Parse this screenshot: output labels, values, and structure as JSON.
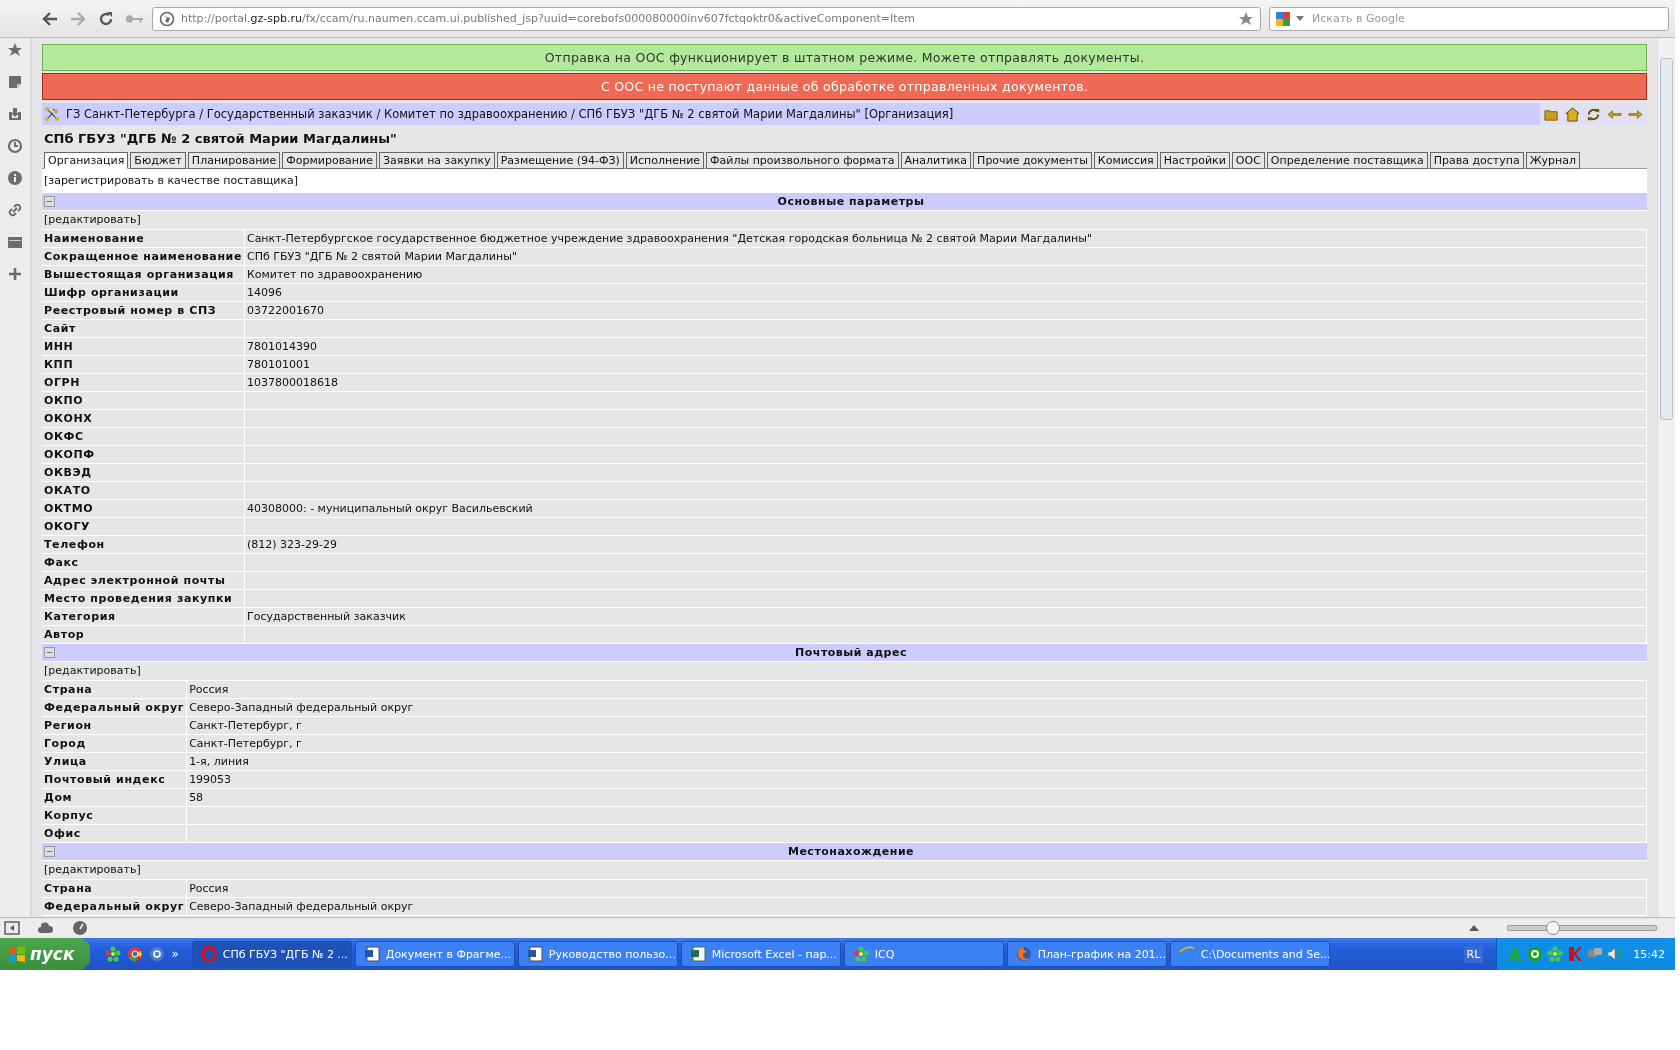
{
  "browser": {
    "url_host_prefix": "http://portal.",
    "url_host": "gz-spb.ru",
    "url_rest": "/fx/ccam/ru.naumen.ccam.ui.published_jsp?uuid=corebofs000080000inv607fctqoktr0&activeComponent=Item",
    "search_placeholder": "Искать в Google"
  },
  "notices": [
    {
      "kind": "ok",
      "text": "Отправка на ООС функционирует в штатном режиме. Можете отправлять документы."
    },
    {
      "kind": "error",
      "text": "С ООС не поступают данные об обработке отправленных документов."
    }
  ],
  "breadcrumb": "ГЗ Санкт-Петербурга / Государственный заказчик / Комитет по здравоохранению / СПб ГБУЗ \"ДГБ № 2 святой Марии Магдалины\" [Организация]",
  "page_title": "СПб ГБУЗ \"ДГБ № 2 святой Марии Магдалины\"",
  "tabs": [
    {
      "label": "Организация",
      "selected": true
    },
    {
      "label": "Бюджет",
      "selected": false
    },
    {
      "label": "Планирование",
      "selected": false
    },
    {
      "label": "Формирование",
      "selected": false
    },
    {
      "label": "Заявки на закупку",
      "selected": false
    },
    {
      "label": "Размещение (94-ФЗ)",
      "selected": false
    },
    {
      "label": "Исполнение",
      "selected": false
    },
    {
      "label": "Файлы произвольного формата",
      "selected": false
    },
    {
      "label": "Аналитика",
      "selected": false
    },
    {
      "label": "Прочие документы",
      "selected": false
    },
    {
      "label": "Комиссия",
      "selected": false
    },
    {
      "label": "Настройки",
      "selected": false
    },
    {
      "label": "ООС",
      "selected": false
    },
    {
      "label": "Определение поставщика",
      "selected": false
    },
    {
      "label": "Права доступа",
      "selected": false
    },
    {
      "label": "Журнал",
      "selected": false
    }
  ],
  "register_link": "[зарегистрировать в качестве поставщика]",
  "sections": [
    {
      "title": "Основные параметры",
      "collapse_mark": "−",
      "edit_link": "[редактировать]",
      "rows": [
        {
          "label": "Наименование",
          "value": "Санкт-Петербургское государственное бюджетное учреждение здравоохранения \"Детская городская больница № 2 святой Марии Магдалины\""
        },
        {
          "label": "Сокращенное наименование",
          "value": "СПб ГБУЗ \"ДГБ № 2 святой Марии Магдалины\""
        },
        {
          "label": "Вышестоящая организация",
          "value": "Комитет по здравоохранению"
        },
        {
          "label": "Шифр организации",
          "value": "14096"
        },
        {
          "label": "Реестровый номер в СПЗ",
          "value": "03722001670"
        },
        {
          "label": "Сайт"
        },
        {
          "label": "ИНН",
          "value": "7801014390"
        },
        {
          "label": "КПП",
          "value": "780101001"
        },
        {
          "label": "ОГРН",
          "value": "1037800018618"
        },
        {
          "label": "ОКПО"
        },
        {
          "label": "ОКОНХ"
        },
        {
          "label": "ОКФС"
        },
        {
          "label": "ОКОПФ"
        },
        {
          "label": "ОКВЭД"
        },
        {
          "label": "ОКАТО"
        },
        {
          "label": "ОКТМО",
          "value": "40308000: - муниципальный округ Васильевский"
        },
        {
          "label": "ОКОГУ"
        },
        {
          "label": "Телефон",
          "value": "(812) 323-29-29"
        },
        {
          "label": "Факс"
        },
        {
          "label": "Адрес электронной почты"
        },
        {
          "label": "Место проведения закупки"
        },
        {
          "label": "Категория",
          "value": "Государственный заказчик"
        },
        {
          "label": "Автор"
        }
      ]
    },
    {
      "title": "Почтовый адрес",
      "collapse_mark": "−",
      "edit_link": "[редактировать]",
      "rows": [
        {
          "label": "Страна",
          "value": "Россия"
        },
        {
          "label": "Федеральный округ",
          "value": "Северо-Западный федеральный округ"
        },
        {
          "label": "Регион",
          "value": "Санкт-Петербург, г"
        },
        {
          "label": "Город",
          "value": "Санкт-Петербург, г"
        },
        {
          "label": "Улица",
          "value": "1-я, линия"
        },
        {
          "label": "Почтовый индекс",
          "value": "199053"
        },
        {
          "label": "Дом",
          "value": "58"
        },
        {
          "label": "Корпус"
        },
        {
          "label": "Офис"
        }
      ]
    },
    {
      "title": "Местонахождение",
      "collapse_mark": "−",
      "edit_link": "[редактировать]",
      "rows": [
        {
          "label": "Страна",
          "value": "Россия"
        },
        {
          "label": "Федеральный округ",
          "value": "Северо-Западный федеральный округ"
        }
      ]
    }
  ],
  "status_bar": {
    "zoom": {
      "level": 0.3
    }
  },
  "taskbar": {
    "start_label": "пуск",
    "more_mark": "»",
    "tasks": [
      {
        "kind": "opera",
        "label": "СПб ГБУЗ \"ДГБ № 2 ...",
        "selected": true
      },
      {
        "kind": "word",
        "label": "Документ в Фрагме...",
        "selected": false
      },
      {
        "kind": "word",
        "label": "Руководство пользо...",
        "selected": false
      },
      {
        "kind": "excel",
        "label": "Microsoft Excel - пар...",
        "selected": false
      },
      {
        "kind": "icq",
        "label": "ICQ",
        "selected": false
      },
      {
        "kind": "firefox",
        "label": "План-график на 201...",
        "selected": false
      },
      {
        "kind": "ie",
        "label": "C:\\Documents and Se...",
        "selected": false
      }
    ],
    "language": "RL",
    "clock": "15:42"
  }
}
